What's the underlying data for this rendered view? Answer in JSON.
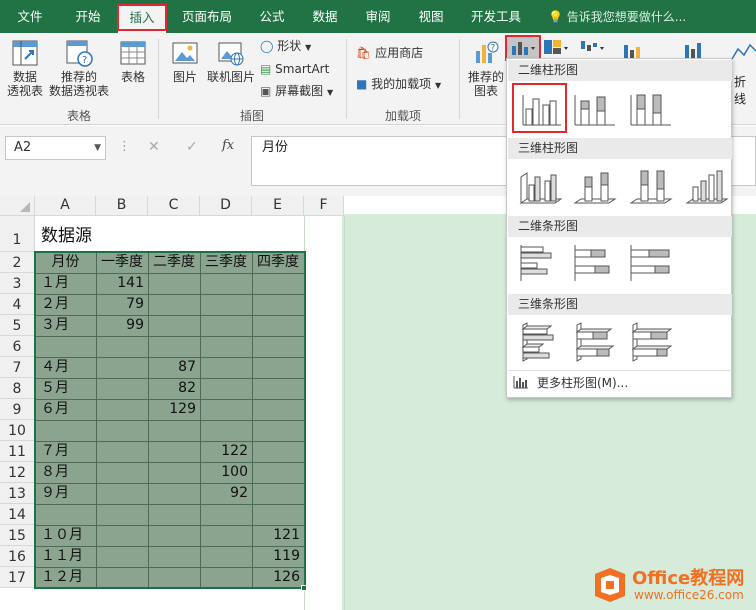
{
  "ribbon_tabs": [
    "文件",
    "开始",
    "插入",
    "页面布局",
    "公式",
    "数据",
    "审阅",
    "视图",
    "开发工具"
  ],
  "tell_me": "告诉我您想要做什么...",
  "ribbon": {
    "pivot_line1": "数据",
    "pivot_line2": "透视表",
    "recpivot_line1": "推荐的",
    "recpivot_line2": "数据透视表",
    "table": "表格",
    "group_tables": "表格",
    "picture": "图片",
    "online_picture": "联机图片",
    "shapes": "形状",
    "smartart": "SmartArt",
    "screenshot": "屏幕截图",
    "group_illustrations": "插图",
    "store": "应用商店",
    "my_addins": "我的加载项",
    "group_addins": "加载项",
    "rec_charts_line1": "推荐的",
    "rec_charts_line2": "图表",
    "line_partial": "折线"
  },
  "formula_bar": {
    "name_box": "A2",
    "fx": "fx",
    "formula": "月份"
  },
  "columns": [
    "A",
    "B",
    "C",
    "D",
    "E",
    "F"
  ],
  "rows": [
    "1",
    "2",
    "3",
    "4",
    "5",
    "6",
    "7",
    "8",
    "9",
    "10",
    "11",
    "12",
    "13",
    "14",
    "15",
    "16",
    "17"
  ],
  "sheet": {
    "title": "数据源",
    "headers": [
      "月份",
      "一季度",
      "二季度",
      "三季度",
      "四季度"
    ],
    "data": [
      [
        "１月",
        "141",
        "",
        "",
        ""
      ],
      [
        "２月",
        "79",
        "",
        "",
        ""
      ],
      [
        "３月",
        "99",
        "",
        "",
        ""
      ],
      [
        "",
        "",
        "",
        "",
        ""
      ],
      [
        "４月",
        "",
        "87",
        "",
        ""
      ],
      [
        "５月",
        "",
        "82",
        "",
        ""
      ],
      [
        "６月",
        "",
        "129",
        "",
        ""
      ],
      [
        "",
        "",
        "",
        "",
        ""
      ],
      [
        "７月",
        "",
        "",
        "122",
        ""
      ],
      [
        "８月",
        "",
        "",
        "100",
        ""
      ],
      [
        "９月",
        "",
        "",
        "92",
        ""
      ],
      [
        "",
        "",
        "",
        "",
        ""
      ],
      [
        "１０月",
        "",
        "",
        "",
        "121"
      ],
      [
        "１１月",
        "",
        "",
        "",
        "119"
      ],
      [
        "１２月",
        "",
        "",
        "",
        "126"
      ]
    ]
  },
  "dropdown": {
    "sec_2d_column": "二维柱形图",
    "sec_3d_column": "三维柱形图",
    "sec_2d_bar": "二维条形图",
    "sec_3d_bar": "三维条形图",
    "more": "更多柱形图(M)..."
  },
  "watermark": {
    "line1": "Office教程网",
    "line2": "www.office26.com"
  },
  "colors": {
    "excel_green": "#217346",
    "highlight_red": "#e0282e",
    "selection_fill": "#8aa48f",
    "background_green": "#d6ebd9"
  }
}
